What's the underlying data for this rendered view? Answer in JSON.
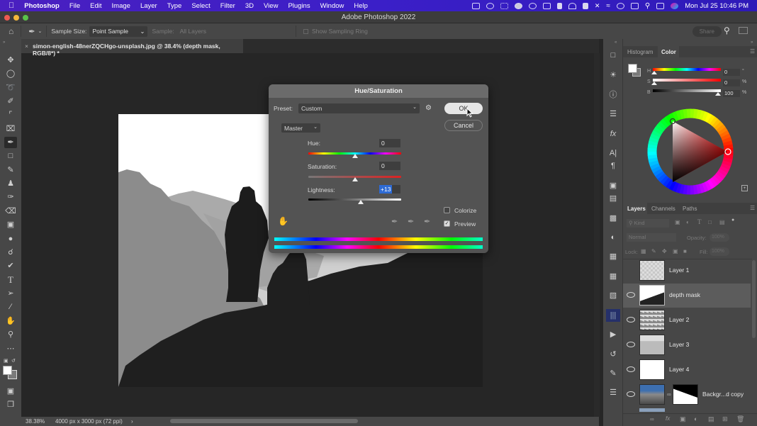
{
  "menubar": {
    "apple": "",
    "app_name": "Photoshop",
    "items": [
      "File",
      "Edit",
      "Image",
      "Layer",
      "Type",
      "Select",
      "Filter",
      "3D",
      "View",
      "Plugins",
      "Window",
      "Help"
    ],
    "status_icons": [
      "screen-record-icon",
      "creative-cloud-icon",
      "dropbox-icon",
      "globe-icon",
      "screencast-icon",
      "airplay-icon",
      "bookmark-icon",
      "arc-icon",
      "layout-icon",
      "bluetooth-icon",
      "wifi-icon",
      "user-icon",
      "battery-icon",
      "search-icon",
      "control-center-icon",
      "siri-icon"
    ],
    "clock": "Mon Jul 25  10:46 PM"
  },
  "window": {
    "title": "Adobe Photoshop 2022"
  },
  "options_bar": {
    "sample_size_label": "Sample Size:",
    "sample_size_value": "Point Sample",
    "sample_label": "Sample:",
    "sample_value": "All Layers",
    "show_sampling_ring": "Show Sampling Ring",
    "share": "Share"
  },
  "document": {
    "tab_title": "simon-english-48nerZQCHgo-unsplash.jpg @ 38.4% (depth mask, RGB/8*) *",
    "zoom": "38.38%",
    "dimensions": "4000 px x 3000 px (72 ppi)",
    "more": "›"
  },
  "dialog": {
    "title": "Hue/Saturation",
    "preset_label": "Preset:",
    "preset_value": "Custom",
    "channel": "Master",
    "hue_label": "Hue:",
    "hue_value": "0",
    "hue_position": 0.5,
    "saturation_label": "Saturation:",
    "saturation_value": "0",
    "saturation_position": 0.5,
    "lightness_label": "Lightness:",
    "lightness_value": "+13",
    "lightness_position": 0.565,
    "ok": "OK",
    "cancel": "Cancel",
    "colorize_label": "Colorize",
    "colorize_checked": false,
    "preview_label": "Preview",
    "preview_checked": true
  },
  "color_panel": {
    "tabs": [
      "Histogram",
      "Color"
    ],
    "active_tab": "Color",
    "h_label": "H",
    "h_value": "0",
    "h_unit": "°",
    "s_label": "S",
    "s_value": "0",
    "s_unit": "%",
    "b_label": "B",
    "b_value": "100",
    "b_unit": "%",
    "foreground": "#ffffff",
    "background": "#7a7a7a"
  },
  "layers_panel": {
    "tabs": [
      "Layers",
      "Channels",
      "Paths"
    ],
    "active_tab": "Layers",
    "filter_placeholder": "Kind",
    "blend_mode": "Normal",
    "opacity_label": "Opacity:",
    "opacity_value": "100%",
    "lock_label": "Lock:",
    "fill_label": "Fill:",
    "fill_value": "100%",
    "layers": [
      {
        "name": "Layer 1",
        "visible": false,
        "selected": false
      },
      {
        "name": "depth mask",
        "visible": true,
        "selected": true
      },
      {
        "name": "Layer 2",
        "visible": true,
        "selected": false
      },
      {
        "name": "Layer 3",
        "visible": true,
        "selected": false
      },
      {
        "name": "Layer 4",
        "visible": true,
        "selected": false
      },
      {
        "name": "Backgr...d copy",
        "visible": true,
        "selected": false
      }
    ]
  }
}
